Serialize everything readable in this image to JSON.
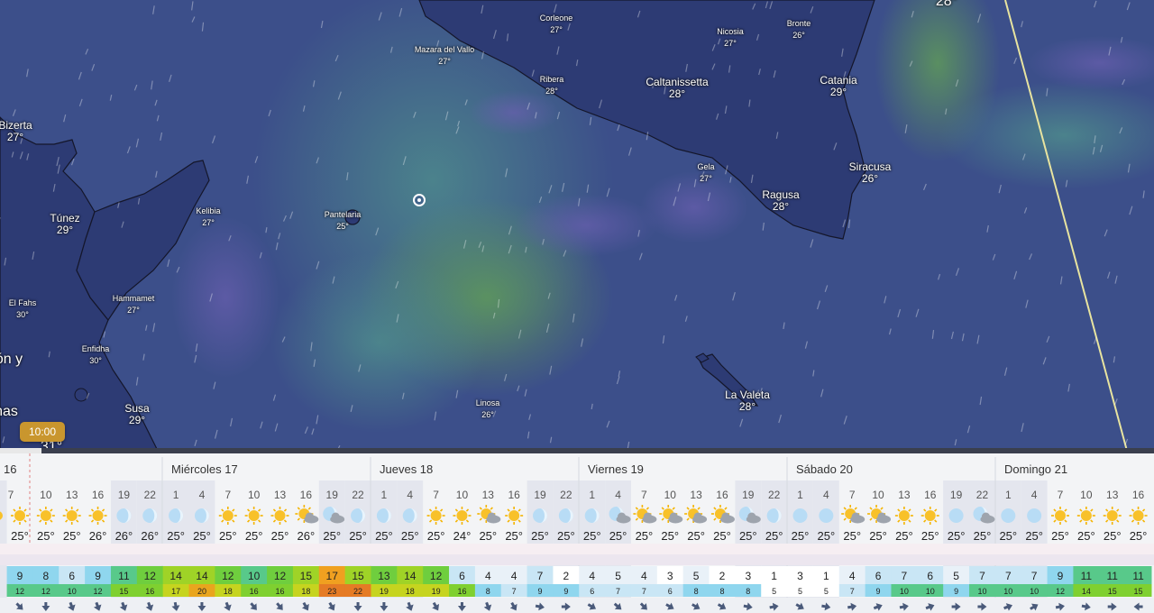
{
  "map": {
    "cities": [
      {
        "name": "Corleone",
        "temp": "27°",
        "size": "sm"
      },
      {
        "name": "Mazara del Vallo",
        "temp": "27°",
        "size": "sm"
      },
      {
        "name": "Nicosia",
        "temp": "27°",
        "size": "sm"
      },
      {
        "name": "Bronte",
        "temp": "26°",
        "size": "sm"
      },
      {
        "name": "Ribera",
        "temp": "28°",
        "size": "sm"
      },
      {
        "name": "Caltanissetta",
        "temp": "28°",
        "size": "big"
      },
      {
        "name": "Catania",
        "temp": "29°",
        "size": "big"
      },
      {
        "name": "Bizerta",
        "temp": "27°",
        "size": "big"
      },
      {
        "name": "Gela",
        "temp": "27°",
        "size": "sm"
      },
      {
        "name": "Siracusa",
        "temp": "26°",
        "size": "big"
      },
      {
        "name": "Ragusa",
        "temp": "28°",
        "size": "big"
      },
      {
        "name": "Túnez",
        "temp": "29°",
        "size": "big"
      },
      {
        "name": "Kelibia",
        "temp": "27°",
        "size": "sm"
      },
      {
        "name": "Pantelaria",
        "temp": "25°",
        "size": "sm"
      },
      {
        "name": "El Fahs",
        "temp": "30°",
        "size": "sm"
      },
      {
        "name": "Hammamet",
        "temp": "27°",
        "size": "sm"
      },
      {
        "name": "Enfidha",
        "temp": "30°",
        "size": "sm"
      },
      {
        "name": "La Valeta",
        "temp": "28°",
        "size": "big"
      },
      {
        "name": "Susa",
        "temp": "29°",
        "size": "big"
      },
      {
        "name": "Linosa",
        "temp": "26°",
        "size": "sm"
      }
    ],
    "edge_labels": [
      "ón y",
      "nas",
      "28°",
      "31°"
    ],
    "time_bubble": "10:00",
    "timeline_progress": 0.036,
    "colors": {
      "sea": "#3c4f8a",
      "land": "#2d3b74",
      "wind_high": "#5f9a5a",
      "wind_mid": "#4d8a8a",
      "track": "#e8e4a0"
    }
  },
  "forecast": {
    "days": [
      {
        "label": "16"
      },
      {
        "label": "Miércoles 17"
      },
      {
        "label": "Jueves 18"
      },
      {
        "label": "Viernes 19"
      },
      {
        "label": "Sábado 20"
      },
      {
        "label": "Domingo 21"
      }
    ],
    "hours": [
      "7",
      "10",
      "13",
      "16",
      "19",
      "22",
      "1",
      "4",
      "7",
      "10",
      "13",
      "16",
      "19",
      "22",
      "1",
      "4",
      "7",
      "10",
      "13",
      "16",
      "19",
      "22",
      "1",
      "4",
      "7",
      "10",
      "13",
      "16",
      "19",
      "22",
      "1",
      "4",
      "7",
      "10",
      "13",
      "16",
      "19",
      "22",
      "1",
      "4",
      "7",
      "10",
      "13",
      "16"
    ],
    "icons": [
      "sun",
      "sun",
      "sun",
      "sun",
      "moon",
      "moon",
      "moon",
      "moon",
      "sun",
      "sun",
      "sun",
      "sun-cloud",
      "moon-cloud",
      "moon",
      "moon",
      "moon",
      "sun",
      "sun",
      "sun-cloud",
      "sun",
      "moon",
      "moon",
      "moon",
      "moon-cloud",
      "sun-cloud",
      "sun-cloud",
      "cloud-sun",
      "sun-cloud",
      "moon-cloud",
      "moon",
      "moon-full",
      "moon-full",
      "sun-cloud",
      "sun-cloud",
      "sun",
      "sun",
      "moon-full",
      "moon-cloud",
      "moon-full",
      "moon-full",
      "sun",
      "sun",
      "sun",
      "sun"
    ],
    "temps": [
      "25°",
      "25°",
      "25°",
      "26°",
      "26°",
      "26°",
      "25°",
      "25°",
      "25°",
      "25°",
      "25°",
      "26°",
      "25°",
      "25°",
      "25°",
      "25°",
      "25°",
      "24°",
      "25°",
      "25°",
      "25°",
      "25°",
      "25°",
      "25°",
      "25°",
      "25°",
      "25°",
      "25°",
      "25°",
      "25°",
      "25°",
      "25°",
      "25°",
      "25°",
      "25°",
      "25°",
      "25°",
      "25°",
      "25°",
      "25°",
      "25°",
      "25°",
      "25°",
      "25°"
    ],
    "wind": [
      "9",
      "8",
      "6",
      "9",
      "11",
      "12",
      "14",
      "14",
      "12",
      "10",
      "12",
      "15",
      "17",
      "15",
      "13",
      "14",
      "12",
      "6",
      "4",
      "4",
      "7",
      "2",
      "4",
      "5",
      "4",
      "3",
      "5",
      "2",
      "3",
      "1",
      "3",
      "1",
      "4",
      "6",
      "7",
      "6",
      "5",
      "7",
      "7",
      "7",
      "9",
      "11",
      "11",
      "11"
    ],
    "gusts": [
      "12",
      "12",
      "10",
      "12",
      "15",
      "16",
      "17",
      "20",
      "18",
      "16",
      "16",
      "18",
      "23",
      "22",
      "19",
      "18",
      "19",
      "16",
      "8",
      "7",
      "9",
      "9",
      "6",
      "7",
      "7",
      "6",
      "8",
      "8",
      "8",
      "5",
      "5",
      "5",
      "7",
      "9",
      "10",
      "10",
      "9",
      "10",
      "10",
      "10",
      "12",
      "14",
      "15",
      "15"
    ],
    "wind_dir_deg": [
      315,
      0,
      340,
      340,
      340,
      340,
      350,
      0,
      340,
      320,
      320,
      330,
      330,
      0,
      0,
      340,
      330,
      0,
      340,
      330,
      280,
      270,
      300,
      310,
      315,
      300,
      300,
      300,
      280,
      260,
      300,
      280,
      260,
      250,
      260,
      250,
      270,
      270,
      250,
      240,
      260,
      280,
      270,
      90
    ]
  }
}
